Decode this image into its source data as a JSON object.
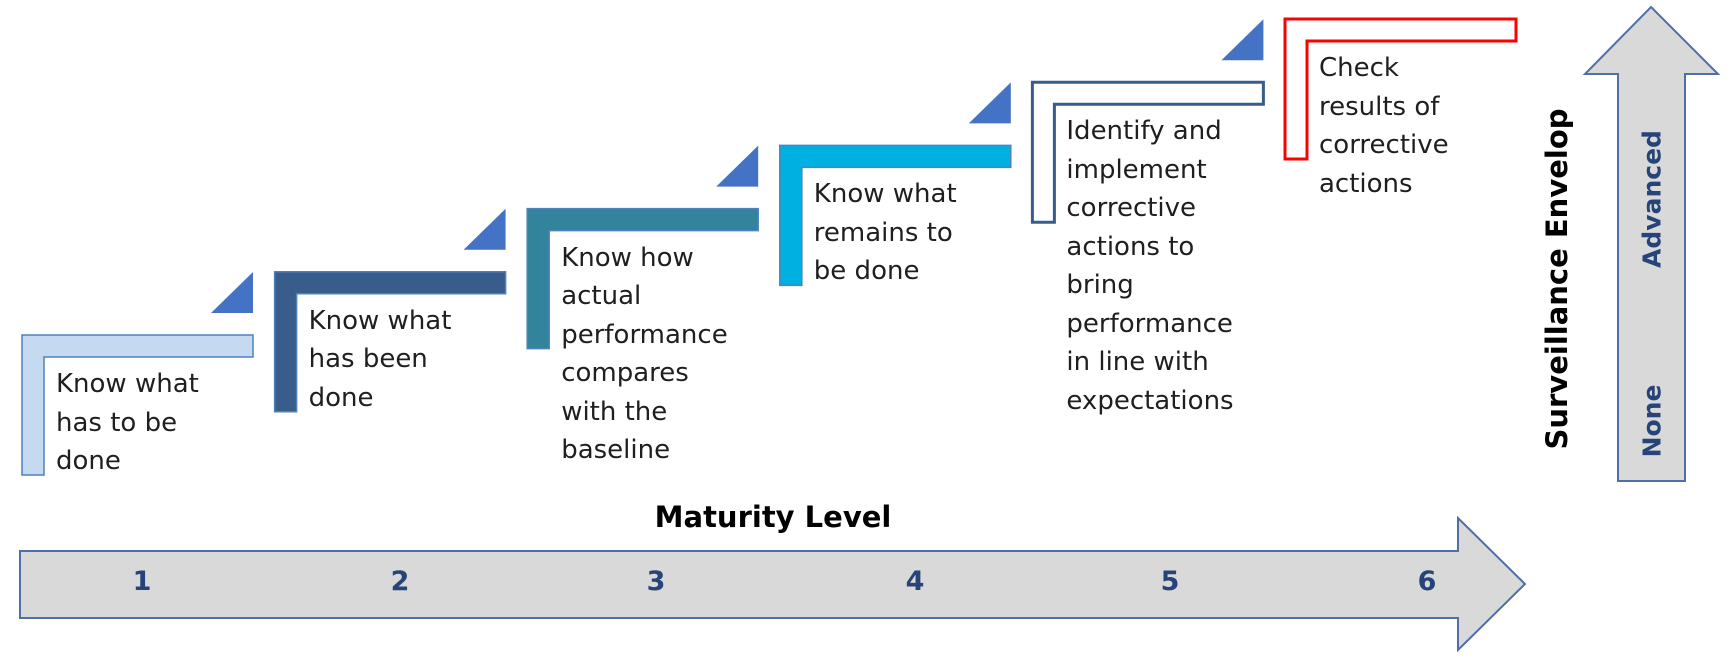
{
  "diagram": {
    "type": "maturity-staircase",
    "x_axis": {
      "title": "Maturity Level",
      "levels": [
        "1",
        "2",
        "3",
        "4",
        "5",
        "6"
      ]
    },
    "y_axis": {
      "title": "Surveillance Envelop",
      "low_label": "None",
      "high_label": "Advanced"
    },
    "steps": [
      {
        "level": "1",
        "text": "Know what\nhas to be\ndone",
        "style": "filled",
        "color": "#C5D9F1",
        "stroke": "#4F81BD"
      },
      {
        "level": "2",
        "text": "Know what\nhas been\ndone",
        "style": "filled",
        "color": "#385D8A",
        "stroke": "#4F81BD"
      },
      {
        "level": "3",
        "text": "Know how\nactual\nperformance\ncompares\nwith the\nbaseline",
        "style": "filled",
        "color": "#31849B",
        "stroke": "#4F81BD"
      },
      {
        "level": "4",
        "text": "Know what\nremains to\nbe done",
        "style": "filled",
        "color": "#00B0E0",
        "stroke": "#4F81BD"
      },
      {
        "level": "5",
        "text": "Identify and\nimplement\ncorrective\nactions to\nbring\nperformance\nin line with\nexpectations",
        "style": "outline",
        "color": "#FFFFFF",
        "stroke": "#385D8A"
      },
      {
        "level": "6",
        "text": "Check\nresults of\ncorrective\nactions",
        "style": "outline",
        "color": "#FFFFFF",
        "stroke": "#FF0000"
      }
    ],
    "colors": {
      "triangle": "#4472C4",
      "arrow_fill": "#D9D9D9",
      "arrow_stroke": "#4F6FA8",
      "axis_label": "#264478"
    }
  }
}
